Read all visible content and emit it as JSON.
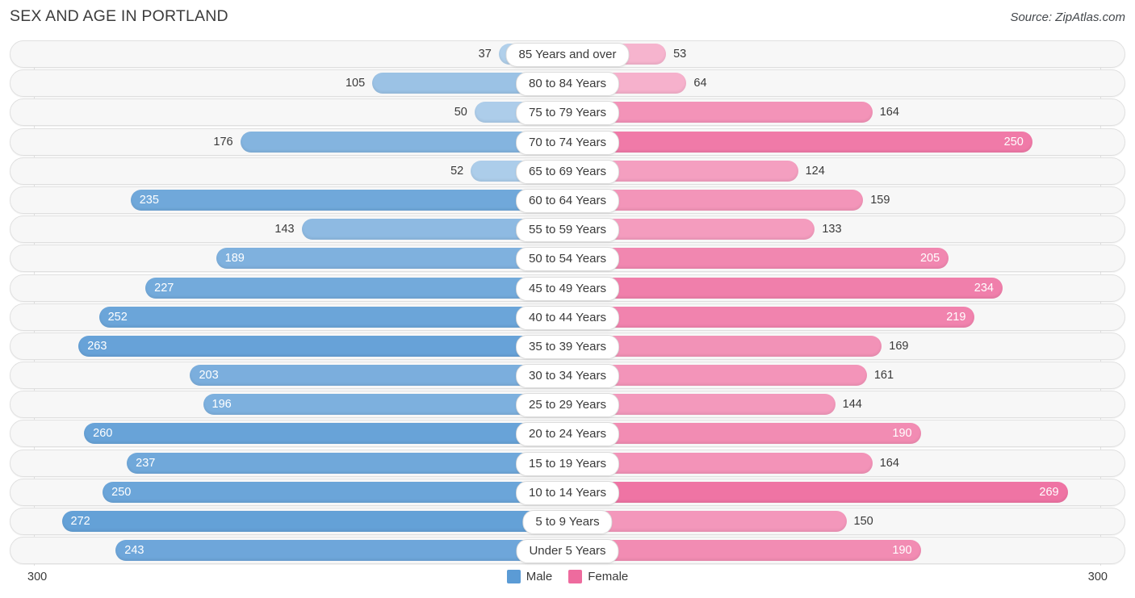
{
  "header": {
    "title": "SEX AND AGE IN PORTLAND",
    "source": "Source: ZipAtlas.com"
  },
  "axis": {
    "left_max_label": "300",
    "right_max_label": "300"
  },
  "legend": {
    "male_label": "Male",
    "female_label": "Female",
    "male_color": "#5b9bd5",
    "female_color": "#ee6b9e"
  },
  "chart_data": {
    "type": "bar",
    "subtype": "population-pyramid",
    "title": "SEX AND AGE IN PORTLAND",
    "xlabel": "",
    "ylabel": "",
    "axis_max": 300,
    "xlim": [
      300,
      300
    ],
    "grid": true,
    "legend_position": "bottom-center",
    "categories": [
      "85 Years and over",
      "80 to 84 Years",
      "75 to 79 Years",
      "70 to 74 Years",
      "65 to 69 Years",
      "60 to 64 Years",
      "55 to 59 Years",
      "50 to 54 Years",
      "45 to 49 Years",
      "40 to 44 Years",
      "35 to 39 Years",
      "30 to 34 Years",
      "25 to 29 Years",
      "20 to 24 Years",
      "15 to 19 Years",
      "10 to 14 Years",
      "5 to 9 Years",
      "Under 5 Years"
    ],
    "series": [
      {
        "name": "Male",
        "color": "#5b9bd5",
        "values": [
          37,
          105,
          50,
          176,
          52,
          235,
          143,
          189,
          227,
          252,
          263,
          203,
          196,
          260,
          237,
          250,
          272,
          243
        ]
      },
      {
        "name": "Female",
        "color": "#ee6b9e",
        "values": [
          53,
          64,
          164,
          250,
          124,
          159,
          133,
          205,
          234,
          219,
          169,
          161,
          144,
          190,
          164,
          269,
          150,
          190
        ]
      }
    ]
  },
  "rows": [
    {
      "label": "85 Years and over",
      "male": 37,
      "female": 53
    },
    {
      "label": "80 to 84 Years",
      "male": 105,
      "female": 64
    },
    {
      "label": "75 to 79 Years",
      "male": 50,
      "female": 164
    },
    {
      "label": "70 to 74 Years",
      "male": 176,
      "female": 250
    },
    {
      "label": "65 to 69 Years",
      "male": 52,
      "female": 124
    },
    {
      "label": "60 to 64 Years",
      "male": 235,
      "female": 159
    },
    {
      "label": "55 to 59 Years",
      "male": 143,
      "female": 133
    },
    {
      "label": "50 to 54 Years",
      "male": 189,
      "female": 205
    },
    {
      "label": "45 to 49 Years",
      "male": 227,
      "female": 234
    },
    {
      "label": "40 to 44 Years",
      "male": 252,
      "female": 219
    },
    {
      "label": "35 to 39 Years",
      "male": 263,
      "female": 169
    },
    {
      "label": "30 to 34 Years",
      "male": 203,
      "female": 161
    },
    {
      "label": "25 to 29 Years",
      "male": 196,
      "female": 144
    },
    {
      "label": "20 to 24 Years",
      "male": 260,
      "female": 190
    },
    {
      "label": "15 to 19 Years",
      "male": 237,
      "female": 164
    },
    {
      "label": "10 to 14 Years",
      "male": 250,
      "female": 269
    },
    {
      "label": "5 to 9 Years",
      "male": 272,
      "female": 150
    },
    {
      "label": "Under 5 Years",
      "male": 243,
      "female": 190
    }
  ]
}
